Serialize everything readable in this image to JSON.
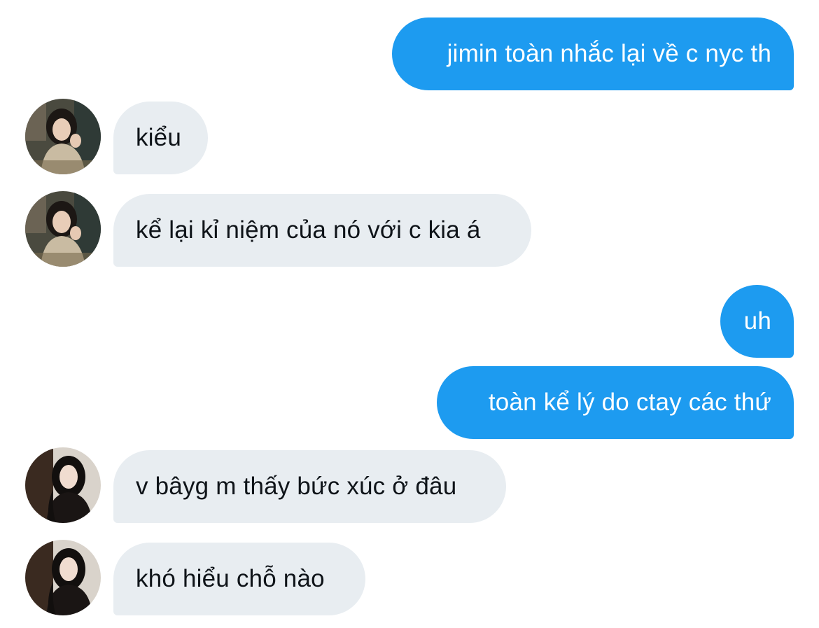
{
  "messages": [
    {
      "id": "m1",
      "direction": "outgoing",
      "text": "jimin toàn nhắc lại về c nyc th"
    },
    {
      "id": "m2",
      "direction": "incoming",
      "sender_avatar": "avatar-photo-girl-sweater",
      "text": "kiểu"
    },
    {
      "id": "m3",
      "direction": "incoming",
      "sender_avatar": "avatar-photo-girl-sweater",
      "text": "kể lại kỉ niệm của nó với c kia á"
    },
    {
      "id": "m4",
      "direction": "outgoing",
      "text": "uh"
    },
    {
      "id": "m5",
      "direction": "outgoing",
      "text": "toàn kể lý do ctay các thứ"
    },
    {
      "id": "m6",
      "direction": "incoming",
      "sender_avatar": "avatar-photo-girl-dark-hair",
      "text": "v bâyg m thấy bức xúc ở đâu"
    },
    {
      "id": "m7",
      "direction": "incoming",
      "sender_avatar": "avatar-photo-girl-dark-hair",
      "text": "khó hiểu chỗ nào"
    }
  ],
  "colors": {
    "outgoing_bubble": "#1d9bf0",
    "outgoing_text": "#ffffff",
    "incoming_bubble": "#e8edf1",
    "incoming_text": "#0f1419",
    "background": "#ffffff"
  }
}
